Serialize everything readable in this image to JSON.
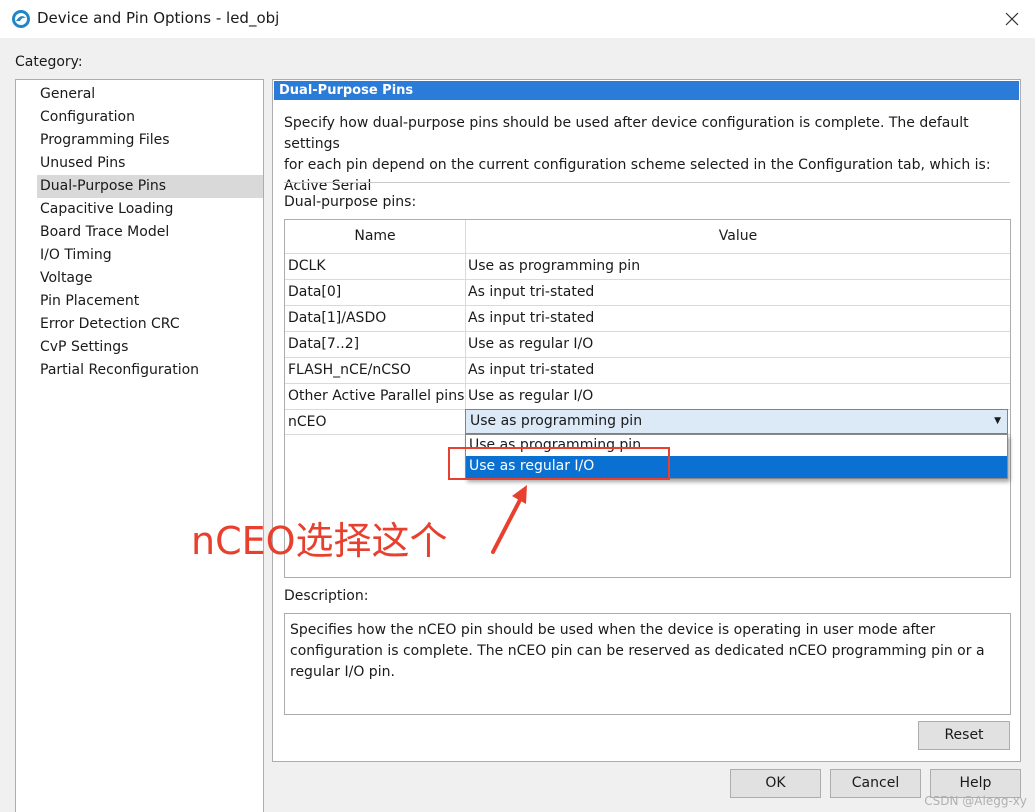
{
  "window": {
    "title": "Device and Pin Options - led_obj",
    "close_glyph": "✕"
  },
  "category": {
    "label": "Category:",
    "items": [
      {
        "label": "General"
      },
      {
        "label": "Configuration"
      },
      {
        "label": "Programming Files"
      },
      {
        "label": "Unused Pins"
      },
      {
        "label": "Dual-Purpose Pins"
      },
      {
        "label": "Capacitive Loading"
      },
      {
        "label": "Board Trace Model"
      },
      {
        "label": "I/O Timing"
      },
      {
        "label": "Voltage"
      },
      {
        "label": "Pin Placement"
      },
      {
        "label": "Error Detection CRC"
      },
      {
        "label": "CvP Settings"
      },
      {
        "label": "Partial Reconfiguration"
      }
    ],
    "selected": "Dual-Purpose Pins"
  },
  "panel": {
    "header": "Dual-Purpose Pins",
    "intro_line1": "Specify how dual-purpose pins should be used after device configuration is complete. The default settings",
    "intro_line2": "for each pin depend on the current configuration scheme selected in the Configuration tab, which is:",
    "intro_line3": "Active Serial",
    "pins_label": "Dual-purpose pins:",
    "table": {
      "headers": {
        "name": "Name",
        "value": "Value"
      },
      "rows": [
        {
          "name": "DCLK",
          "value": "Use as programming pin"
        },
        {
          "name": "Data[0]",
          "value": "As input tri-stated"
        },
        {
          "name": "Data[1]/ASDO",
          "value": "As input tri-stated"
        },
        {
          "name": "Data[7..2]",
          "value": "Use as regular I/O"
        },
        {
          "name": "FLASH_nCE/nCSO",
          "value": "As input tri-stated"
        },
        {
          "name": "Other Active Parallel pins",
          "value": "Use as regular I/O"
        },
        {
          "name": "nCEO",
          "value": "Use as programming pin"
        }
      ]
    },
    "dropdown": {
      "arrow_glyph": "▼",
      "options": [
        "Use as programming pin",
        "Use as regular I/O"
      ],
      "highlighted": "Use as regular I/O"
    },
    "annotation": "nCEO选择这个",
    "description_label": "Description:",
    "description_line1": "Specifies how the nCEO pin should be used when the device is operating in user mode after",
    "description_line2": "configuration is complete. The nCEO pin can be reserved as dedicated nCEO programming pin or a",
    "description_line3": "regular I/O pin.",
    "reset_label": "Reset"
  },
  "footer": {
    "ok_label": "OK",
    "cancel_label": "Cancel",
    "help_label": "Help"
  },
  "watermark": "CSDN @Alegg-xy",
  "colors": {
    "header_blue": "#2b7bd8",
    "selection_blue": "#0a71d3",
    "annotation_red": "#e8402e"
  }
}
